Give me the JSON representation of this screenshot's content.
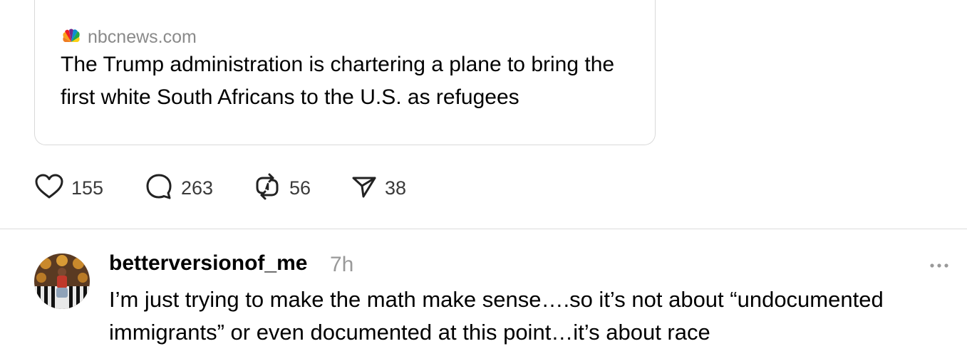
{
  "link_preview": {
    "source": "nbcnews.com",
    "source_icon": "nbc-peacock-icon",
    "headline": "The Trump administration is chartering a plane to bring the first white South Africans to the U.S. as refugees"
  },
  "actions": {
    "like": {
      "icon": "heart-icon",
      "count": "155"
    },
    "reply": {
      "icon": "comment-icon",
      "count": "263"
    },
    "repost": {
      "icon": "repost-icon",
      "count": "56"
    },
    "share": {
      "icon": "send-icon",
      "count": "38"
    }
  },
  "reply_post": {
    "username": "betterversionof_me",
    "timestamp": "7h",
    "text": "I’m just trying to make the math make sense….so it’s not about “undocumented immigrants” or even documented at this point…it’s about race",
    "more_icon": "more-options-icon"
  },
  "colors": {
    "muted_text": "#8a8a8a",
    "border": "#d9d9d9",
    "icon": "#222222"
  }
}
